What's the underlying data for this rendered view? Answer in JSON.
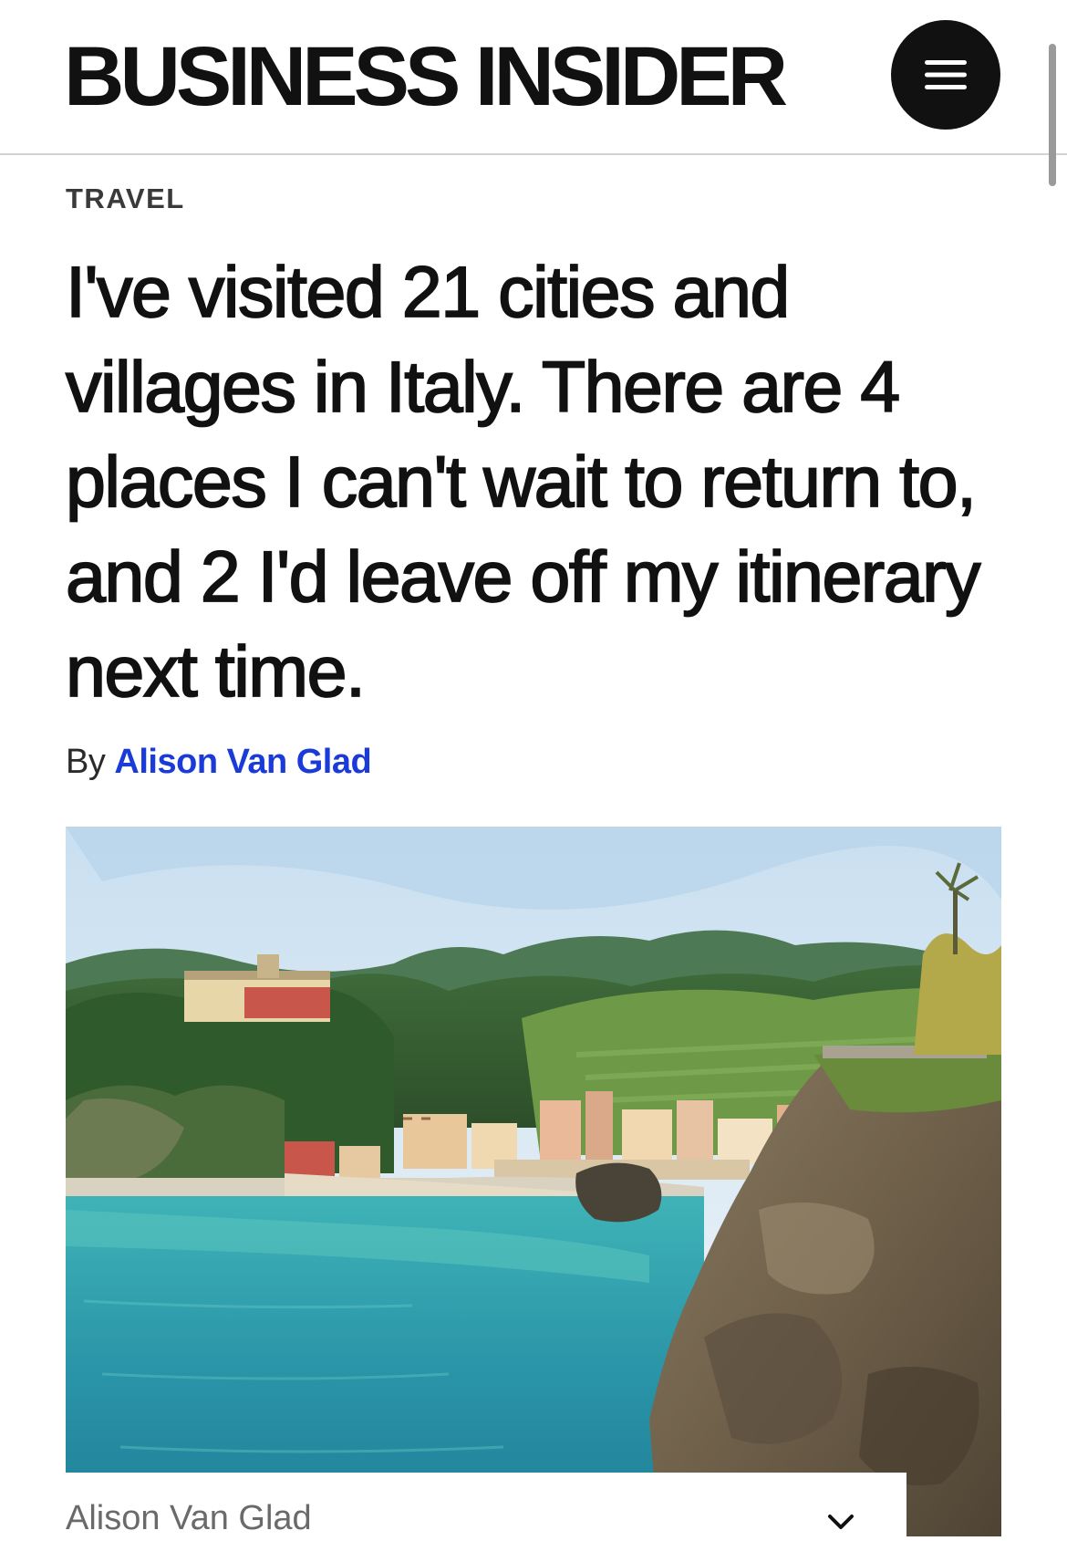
{
  "header": {
    "logo_text": "BUSINESS INSIDER",
    "menu_icon": "hamburger-menu-icon"
  },
  "article": {
    "category": "TRAVEL",
    "headline": "I've visited 21 cities and villages in Italy. There are 4 places I can't wait to return to, and 2 I'd leave off my itinerary next time.",
    "byline_prefix": "By",
    "author": "Alison Van Glad"
  },
  "hero_image": {
    "caption_credit": "Alison Van Glad",
    "caption_toggle_icon": "chevron-down-icon"
  },
  "colors": {
    "text": "#111111",
    "author_link": "#1b3bd8",
    "divider": "#d3d3d3",
    "caption": "#6a6a6a"
  }
}
